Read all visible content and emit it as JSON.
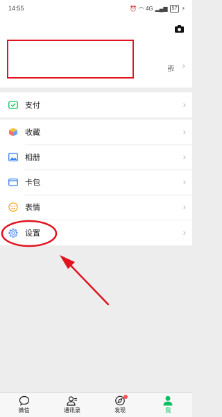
{
  "status_bar": {
    "time": "14:55",
    "network": "4G",
    "battery": "57"
  },
  "profile": {
    "camera_icon": "camera-icon",
    "qr_icon": "qr-code-icon"
  },
  "menu": {
    "pay": {
      "label": "支付",
      "icon": "pay-icon"
    },
    "favorites": {
      "label": "收藏",
      "icon": "cube-icon"
    },
    "album": {
      "label": "相册",
      "icon": "picture-icon"
    },
    "cards": {
      "label": "卡包",
      "icon": "wallet-icon"
    },
    "stickers": {
      "label": "表情",
      "icon": "smiley-icon"
    },
    "settings": {
      "label": "设置",
      "icon": "gear-icon"
    }
  },
  "tabs": [
    {
      "label": "微信",
      "icon": "chat-icon"
    },
    {
      "label": "通讯录",
      "icon": "contacts-icon"
    },
    {
      "label": "发现",
      "icon": "compass-icon"
    },
    {
      "label": "我",
      "icon": "person-icon",
      "active": true
    }
  ],
  "colors": {
    "accent": "#07c160",
    "annotation": "#e0141e",
    "badge": "#fa5151"
  }
}
